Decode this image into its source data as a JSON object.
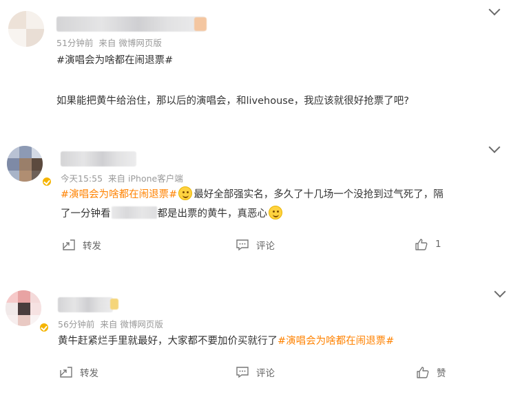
{
  "colors": {
    "topic": "#ff8200",
    "meta": "#999999",
    "text": "#333333",
    "badge": "#f5b400"
  },
  "posts": [
    {
      "time": "51分钟前",
      "source": "来自 微博网页版",
      "topic": "#演唱会为啥都在闹退票#",
      "text": "如果能把黄牛给治住，那以后的演唱会，和livehouse，我应该就很好抢票了吧?",
      "icon": "chevron-down-icon"
    },
    {
      "time": "今天15:55",
      "source": "来自 iPhone客户端",
      "topic": "#演唱会为啥都在闹退票#",
      "text_a": "最好全部强实名，多久了十几场一个没抢到过气死了，隔",
      "text_b": "了一分钟看",
      "text_c": "都是出票的黄牛，真恶心",
      "repost_label": "转发",
      "comment_label": "评论",
      "like_label": "1"
    },
    {
      "time": "56分钟前",
      "source": "来自 微博网页版",
      "text": "黄牛赶紧烂手里就最好，大家都不要加价买就行了",
      "topic": "#演唱会为啥都在闹退票#",
      "repost_label": "转发",
      "comment_label": "评论",
      "like_label": "赞"
    }
  ]
}
